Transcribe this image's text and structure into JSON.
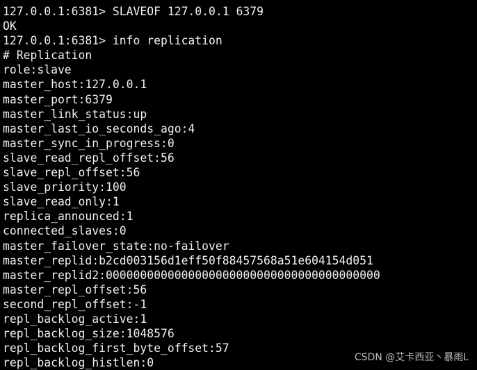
{
  "terminal": {
    "lines": [
      "127.0.0.1:6381> SLAVEOF 127.0.0.1 6379",
      "OK",
      "127.0.0.1:6381> info replication",
      "# Replication",
      "role:slave",
      "master_host:127.0.0.1",
      "master_port:6379",
      "master_link_status:up",
      "master_last_io_seconds_ago:4",
      "master_sync_in_progress:0",
      "slave_read_repl_offset:56",
      "slave_repl_offset:56",
      "slave_priority:100",
      "slave_read_only:1",
      "replica_announced:1",
      "connected_slaves:0",
      "master_failover_state:no-failover",
      "master_replid:b2cd003156d1eff50f88457568a51e604154d051",
      "master_replid2:0000000000000000000000000000000000000000",
      "master_repl_offset:56",
      "second_repl_offset:-1",
      "repl_backlog_active:1",
      "repl_backlog_size:1048576",
      "repl_backlog_first_byte_offset:57",
      "repl_backlog_histlen:0"
    ]
  },
  "watermark": "CSDN @艾卡西亚丶暴雨L"
}
